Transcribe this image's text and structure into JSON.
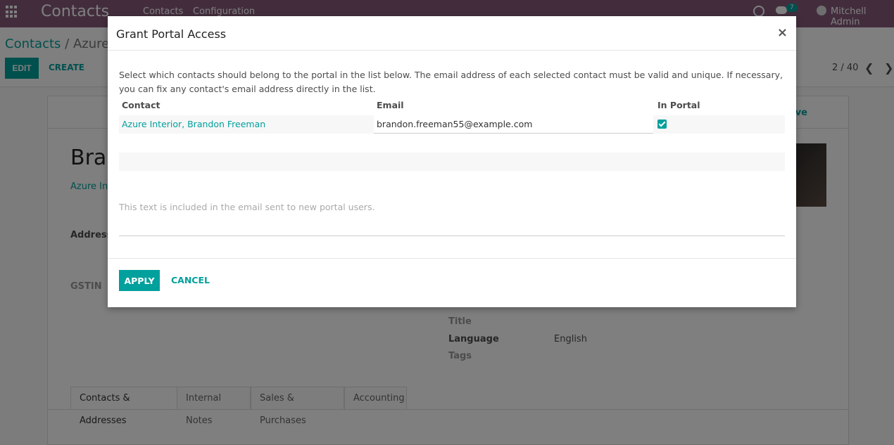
{
  "navbar": {
    "brand": "Contacts",
    "menu": [
      "Contacts",
      "Configuration"
    ],
    "chat_count": "7",
    "user": "Mitchell Admin"
  },
  "control": {
    "breadcrumb_parent": "Contacts",
    "breadcrumb_sep": "/",
    "breadcrumb_current": "Azure I",
    "edit_label": "EDIT",
    "create_label": "CREATE",
    "pager": "2 / 40"
  },
  "form": {
    "archive_partial": "ive",
    "name_partial": "Bran",
    "company_partial": "Azure Inte",
    "address_label": "Address",
    "gstin_label": "GSTIN",
    "title_label": "Title",
    "language_label": "Language",
    "language_value": "English",
    "tags_label": "Tags",
    "tabs": [
      "Contacts & Addresses",
      "Internal Notes",
      "Sales & Purchases",
      "Accounting"
    ]
  },
  "modal": {
    "title": "Grant Portal Access",
    "close": "×",
    "intro": "Select which contacts should belong to the portal in the list below. The email address of each selected contact must be valid and unique. If necessary, you can fix any contact's email address directly in the list.",
    "columns": {
      "contact": "Contact",
      "email": "Email",
      "in_portal": "In Portal"
    },
    "rows": [
      {
        "contact": "Azure Interior, Brandon Freeman",
        "email": "brandon.freeman55@example.com",
        "in_portal": true
      }
    ],
    "welcome_placeholder": "This text is included in the email sent to new portal users.",
    "apply_label": "APPLY",
    "cancel_label": "CANCEL"
  },
  "colors": {
    "brand": "#875a7b",
    "accent": "#00a09d"
  }
}
